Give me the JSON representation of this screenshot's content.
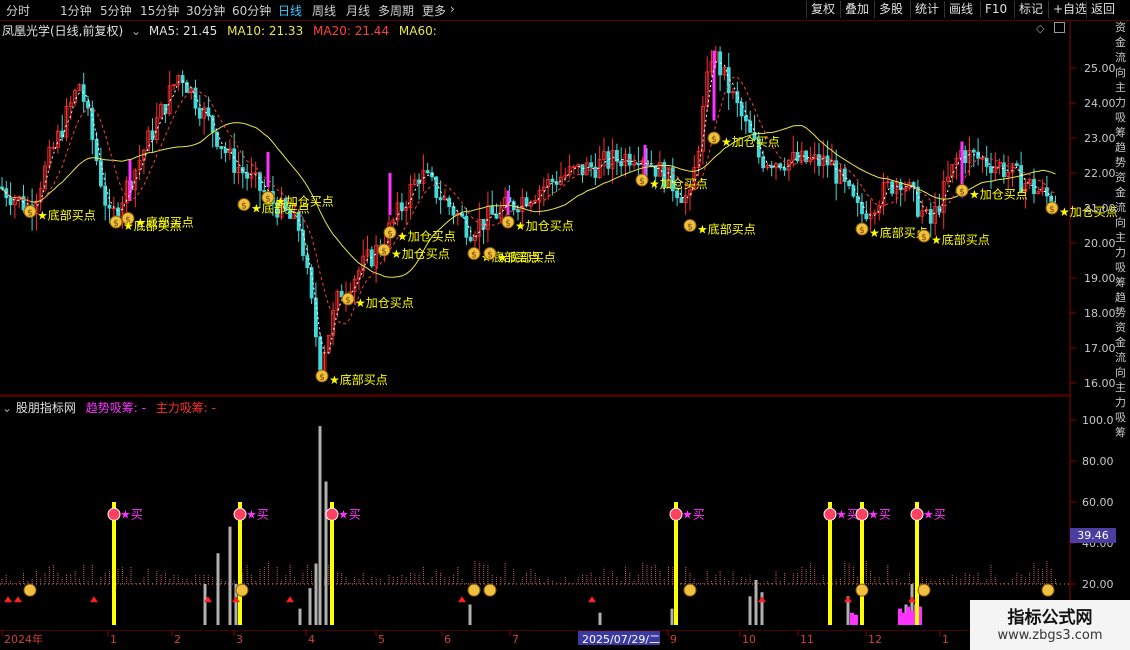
{
  "toolbar": {
    "periods": [
      "分时",
      "1分钟",
      "5分钟",
      "15分钟",
      "30分钟",
      "60分钟",
      "日线",
      "周线",
      "月线",
      "多周期",
      "更多"
    ],
    "active_period": "日线",
    "buttons": [
      "复权",
      "叠加",
      "多股",
      "统计",
      "画线",
      "F10",
      "标记",
      "+自选",
      "返回"
    ]
  },
  "main_header": {
    "title": "凤凰光学(日线,前复权)",
    "ma5": "MA5: 21.45",
    "ma10": "MA10: 21.33",
    "ma20": "MA20: 21.44",
    "ma60": "MA60:"
  },
  "sub_header": {
    "title": "股朋指标网",
    "trend": "趋势吸筹: -",
    "main": "主力吸筹: -"
  },
  "price_axis": [
    "25.00",
    "24.00",
    "23.00",
    "22.00",
    "21.00",
    "20.00",
    "19.00",
    "18.00",
    "17.00",
    "16.00"
  ],
  "sub_axis": [
    "100.0",
    "80.00",
    "60.00",
    "40.00",
    "20.00"
  ],
  "sub_value_tag": "39.46",
  "x_axis": [
    "2024年",
    "1",
    "2",
    "3",
    "4",
    "5",
    "6",
    "7",
    "2025/07/29/二",
    "9",
    "10",
    "11",
    "12",
    "1"
  ],
  "signals": {
    "bottom": "底部买点",
    "add": "加仓买点",
    "buy": "买"
  },
  "right_strip": "资金流向主力吸筹趋势资金流向主力吸筹趋势资金流向主力吸筹",
  "watermark": {
    "title": "指标公式网",
    "url": "www.zbgs3.com"
  },
  "colors": {
    "up": "#ff3030",
    "down": "#44d8d8",
    "ma_yellow": "#e8e850",
    "signal_magenta": "#ff33ff",
    "signal_yellow": "#ffff00"
  }
}
